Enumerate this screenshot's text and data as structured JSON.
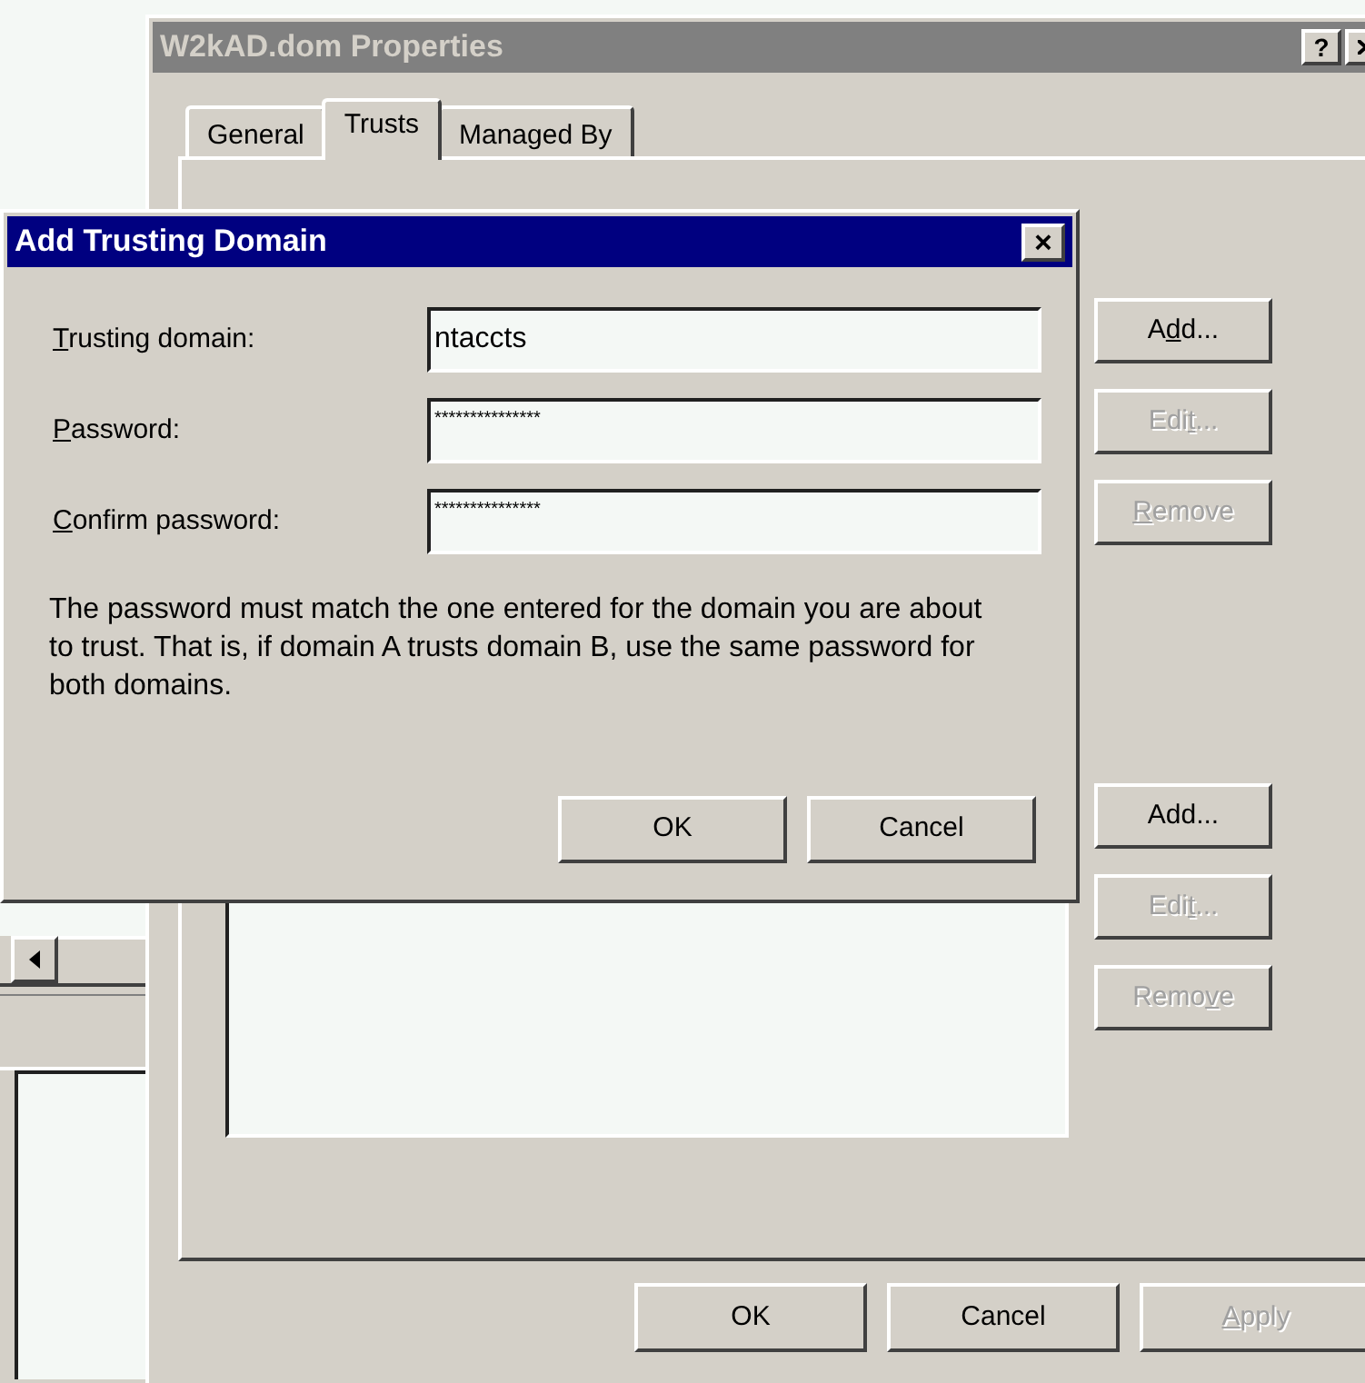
{
  "properties_window": {
    "title": "W2kAD.dom Properties",
    "active": false,
    "title_buttons": [
      "?"
    ],
    "tabs": [
      {
        "label": "General",
        "selected": false
      },
      {
        "label": "Trusts",
        "selected": true
      },
      {
        "label": "Managed By",
        "selected": false
      }
    ],
    "upper_buttons": [
      {
        "label": {
          "pre": "A",
          "key": "d",
          "post": "d..."
        },
        "disabled": false
      },
      {
        "label": {
          "pre": "Edi",
          "key": "t",
          "post": "..."
        },
        "disabled": true
      },
      {
        "label": {
          "key": "R",
          "post": "emove"
        },
        "disabled": true
      }
    ],
    "lower_buttons": [
      {
        "label": {
          "pre": "Add..."
        },
        "disabled": false
      },
      {
        "label": {
          "pre": "Edi",
          "key": "t",
          "post": "..."
        },
        "disabled": true
      },
      {
        "label": {
          "pre": "Remo",
          "key": "v",
          "post": "e"
        },
        "disabled": true
      }
    ],
    "footer_buttons": [
      {
        "label": {
          "pre": "OK"
        },
        "disabled": false
      },
      {
        "label": {
          "pre": "Cancel"
        },
        "disabled": false
      },
      {
        "label": {
          "key": "A",
          "post": "pply"
        },
        "disabled": true
      }
    ]
  },
  "dialog": {
    "title": "Add Trusting Domain",
    "active": true,
    "close_button": "×",
    "fields": [
      {
        "label": {
          "key": "T",
          "post": "rusting domain:"
        },
        "value": "ntaccts",
        "kind": "text"
      },
      {
        "label": {
          "key": "P",
          "post": "assword:"
        },
        "value": "***************",
        "kind": "password"
      },
      {
        "label": {
          "key": "C",
          "post": "onfirm password:"
        },
        "value": "***************",
        "kind": "password"
      }
    ],
    "message": "The password must match the one entered for the domain you are about to trust. That is, if domain A trusts domain B, use the same password for both domains.",
    "buttons": [
      {
        "label": {
          "pre": "OK"
        },
        "disabled": false
      },
      {
        "label": {
          "pre": "Cancel"
        },
        "disabled": false
      }
    ]
  }
}
